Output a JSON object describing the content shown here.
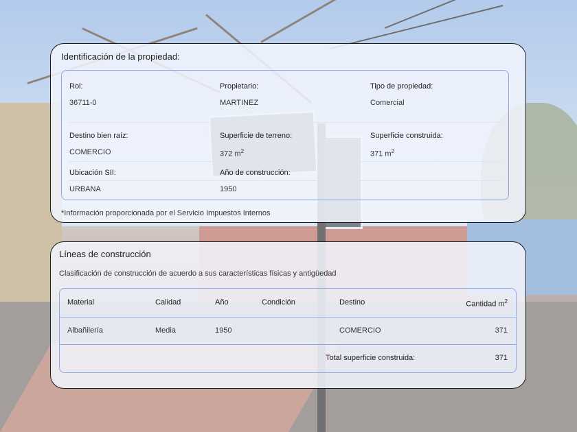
{
  "property": {
    "title": "Identificación de la propiedad:",
    "rol_label": "Rol:",
    "rol_value": "36711-0",
    "owner_label": "Propietario:",
    "owner_value": "MARTINEZ",
    "type_label": "Tipo de propiedad:",
    "type_value": "Comercial",
    "destination_label": "Destino bien raíz:",
    "destination_value": "COMERCIO",
    "land_area_label": "Superficie de terreno:",
    "land_area_value": "372 m",
    "built_area_label": "Superficie construida:",
    "built_area_value": "371 m",
    "unit_exponent": "2",
    "location_label": "Ubicación SII:",
    "location_value": "URBANA",
    "year_label": "Año de construcción:",
    "year_value": "1950",
    "footnote": "*Información proporcionada por el Servicio Impuestos Internos"
  },
  "construction": {
    "title": "Líneas de construcción",
    "subtitle": "Clasificación de construcción de acuerdo a sus características físicas y antigüedad",
    "headers": {
      "material": "Material",
      "quality": "Calidad",
      "year": "Año",
      "condition": "Condición",
      "destination": "Destino",
      "quantity": "Cantidad m",
      "quantity_exp": "2"
    },
    "rows": [
      {
        "material": "Albañilería",
        "quality": "Media",
        "year": "1950",
        "condition": "",
        "destination": "COMERCIO",
        "quantity": "371"
      }
    ],
    "total_label": "Total superficie construida:",
    "total_value": "371"
  },
  "colors": {
    "card_bg": "#f1f5fd",
    "border_accent": "#8fa9e8",
    "card_border": "#1c1c1c"
  }
}
